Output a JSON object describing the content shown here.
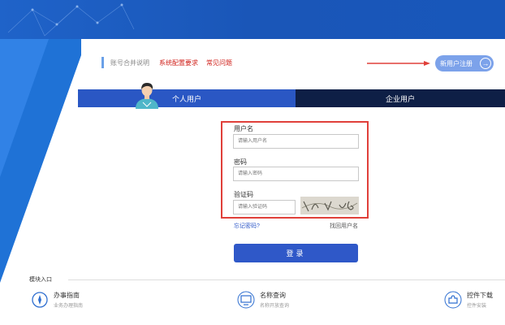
{
  "header": {
    "account_merge_label": "账号合并说明",
    "system_requirements_label": "系统配置要求",
    "faq_label": "常见问题",
    "register_button_label": "新用户注册"
  },
  "tabs": [
    {
      "label": "个人用户",
      "active": true
    },
    {
      "label": "企业用户",
      "active": false
    }
  ],
  "form": {
    "username_label": "用户名",
    "username_placeholder": "请输入用户名",
    "password_label": "密码",
    "password_placeholder": "请输入密码",
    "captcha_label": "验证码",
    "captcha_placeholder": "请输入验证码",
    "forgot_password": "忘记密码?",
    "retrieve_username": "找回用户名",
    "login_button": "登录"
  },
  "modules": {
    "title": "模块入口",
    "items": [
      {
        "title": "办事指南",
        "subtitle": "业务办理指南",
        "icon": "compass-icon"
      },
      {
        "title": "名称查询",
        "subtitle": "名称开放查询",
        "icon": "monitor-icon"
      },
      {
        "title": "控件下载",
        "subtitle": "控件安装",
        "icon": "plugin-icon"
      }
    ]
  },
  "colors": {
    "banner": "#1f63c9",
    "tab_active": "#2a57c4",
    "tab_inactive": "#0e1f46",
    "highlight_border": "#e0403a",
    "login_button": "#2f58c8",
    "link_red": "#d0211b"
  }
}
